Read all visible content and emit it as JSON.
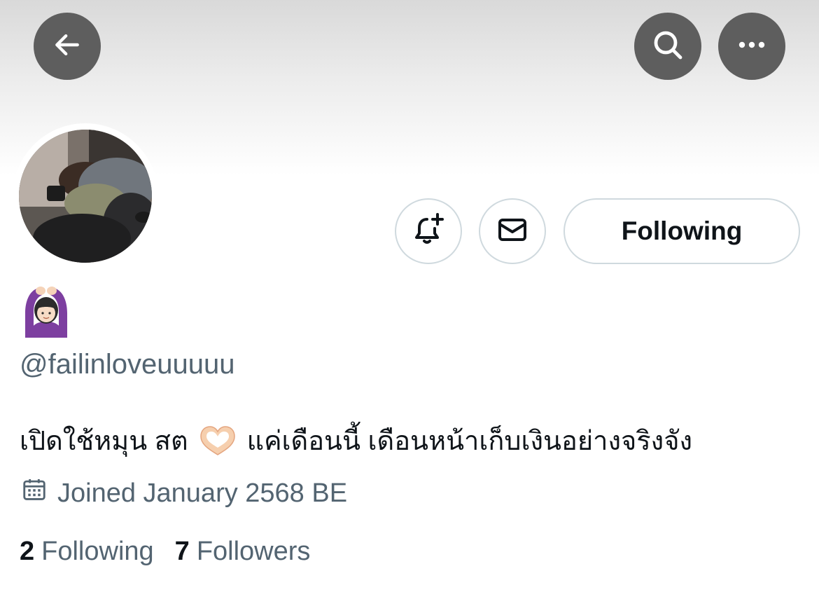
{
  "header": {
    "back_icon": "arrow-left-icon",
    "search_icon": "search-icon",
    "more_icon": "more-horizontal-icon"
  },
  "profile": {
    "display_name_emoji": "🙆🏻‍♀️",
    "handle": "@failinloveuuuuu",
    "bio_part1": "เปิดใช้หมุน สต",
    "bio_emoji": "🫶🏻",
    "bio_part2": "แค่เดือนนี้ เดือนหน้าเก็บเงินอย่างจริงจัง",
    "joined": "Joined January 2568 BE",
    "following_count": "2",
    "following_label": "Following",
    "followers_count": "7",
    "followers_label": "Followers"
  },
  "actions": {
    "notify_icon": "bell-plus-icon",
    "message_icon": "envelope-icon",
    "following_button": "Following"
  },
  "colors": {
    "text_primary": "#0f1419",
    "text_secondary": "#536471",
    "button_border": "#cfd9de",
    "header_button_bg": "#5e5e5e"
  }
}
